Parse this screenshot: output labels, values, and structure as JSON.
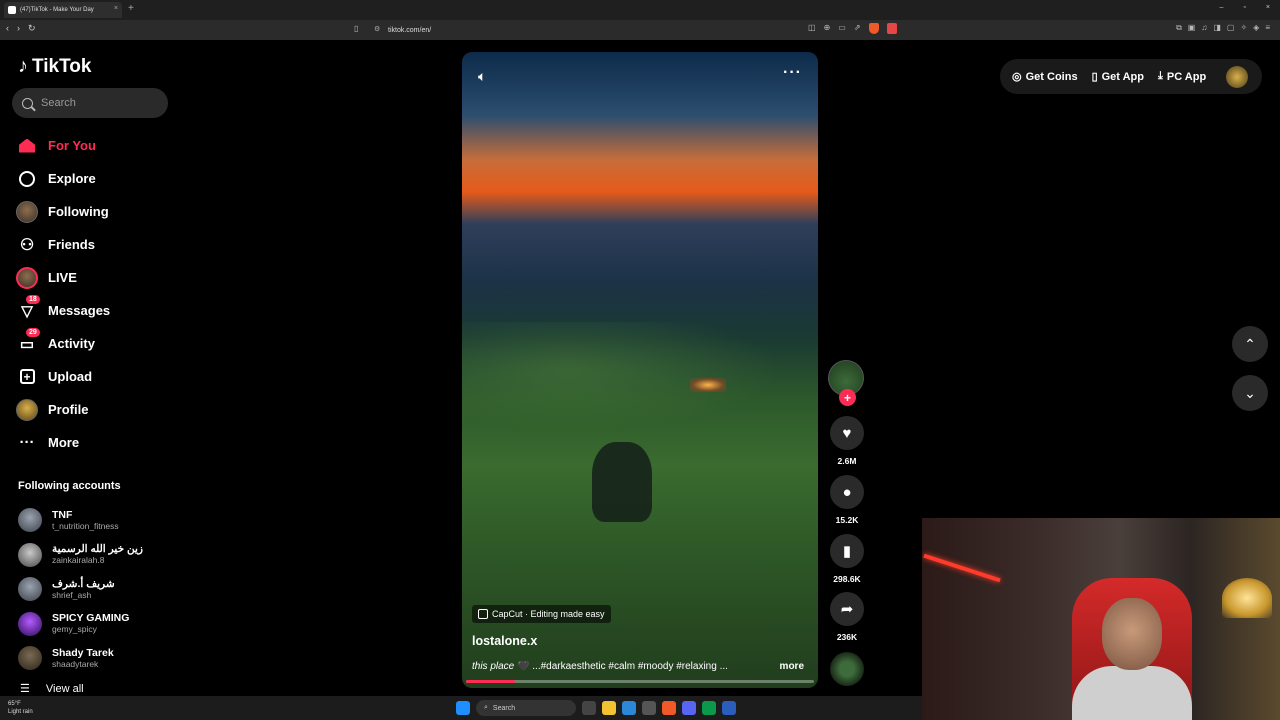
{
  "browser": {
    "tab_title": "(47)TikTok - Make Your Day",
    "tab_close": "×",
    "new_tab": "+",
    "url": "tiktok.com/en/",
    "window_controls": [
      "–",
      "▫",
      "×"
    ]
  },
  "sidebar": {
    "logo_text": "TikTok",
    "search_placeholder": "Search",
    "nav": [
      {
        "label": "For You",
        "icon": "home-icon"
      },
      {
        "label": "Explore",
        "icon": "compass-icon"
      },
      {
        "label": "Following",
        "icon": "following-avatar"
      },
      {
        "label": "Friends",
        "icon": "friends-icon"
      },
      {
        "label": "LIVE",
        "icon": "live-avatar"
      },
      {
        "label": "Messages",
        "icon": "messages-icon",
        "badge": "18"
      },
      {
        "label": "Activity",
        "icon": "activity-icon",
        "badge": "29"
      },
      {
        "label": "Upload",
        "icon": "upload-icon"
      },
      {
        "label": "Profile",
        "icon": "profile-avatar"
      },
      {
        "label": "More",
        "icon": "more-icon"
      }
    ],
    "following_header": "Following accounts",
    "accounts": [
      {
        "name": "TNF",
        "handle": "t_nutrition_fitness"
      },
      {
        "name": "زين خير الله الرسمية",
        "handle": "zainkairalah.8"
      },
      {
        "name": "شريف أ.شرف",
        "handle": "shrief_ash"
      },
      {
        "name": "SPICY GAMING",
        "handle": "gemy_spicy"
      },
      {
        "name": "Shady Tarek",
        "handle": "shaadytarek"
      }
    ],
    "view_all": "View all"
  },
  "video": {
    "capcut_label": "CapCut · Editing made easy",
    "username": "lostalone.x",
    "caption_desc": "this place",
    "caption_heart": "🖤",
    "caption_tags": " ...#darkaesthetic #calm #moody #relaxing ...",
    "more_label": "more",
    "progress": 0.14
  },
  "actions": {
    "likes": "2.6M",
    "comments": "15.2K",
    "saves": "298.6K",
    "shares": "236K"
  },
  "topbar": {
    "get_coins": "Get Coins",
    "get_app": "Get App",
    "pc_app": "PC App"
  },
  "taskbar": {
    "weather_temp": "65°F",
    "weather_desc": "Light rain",
    "search": "Search"
  },
  "colors": {
    "accent": "#fe2c55",
    "background": "#000000",
    "panel": "#2a2a2a"
  }
}
